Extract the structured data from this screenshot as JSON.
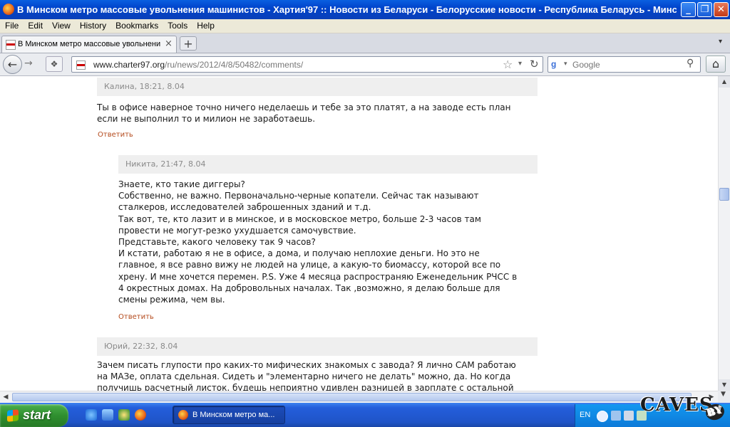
{
  "window": {
    "title": "В Минском метро массовые увольнения машинистов - Хартия'97 :: Новости из Беларуси - Белорусские новости - Республика Беларусь - Минс...",
    "minimize_glyph": "_",
    "maximize_glyph": "❐",
    "close_glyph": "✕"
  },
  "menu": [
    "File",
    "Edit",
    "View",
    "History",
    "Bookmarks",
    "Tools",
    "Help"
  ],
  "tab": {
    "label": "В Минском метро массовые увольнения ма...",
    "close_glyph": "×",
    "new_tab_glyph": "+",
    "list_glyph": "▾"
  },
  "nav": {
    "back_glyph": "←",
    "forward_glyph": "→",
    "url_host": "www.charter97.org",
    "url_path": "/ru/news/2012/4/8/50482/comments/",
    "star_glyph": "☆",
    "drop_glyph": "▾",
    "reload_glyph": "↻",
    "search_engine_glyph": "g",
    "search_placeholder": "Google",
    "search_glyph": "⚲",
    "home_glyph": "⌂"
  },
  "comments": [
    {
      "header": "Калина, 18:21, 8.04",
      "text": "Ты в офисе наверное точно ничего неделаешь и тебе за это платят, а на заводе есть план\nесли не выполнил то и милион не заработаешь.",
      "reply_label": "Ответить"
    },
    {
      "header": "Никита, 21:47, 8.04",
      "text": "Знаете, кто такие диггеры?\nСобственно, не важно. Первоначально-черные копатели. Сейчас так называют\nсталкеров, исследователей заброшенных зданий и т.д.\nТак вот, те, кто лазит и в минское, и в московское метро, больше 2-3 часов там\nпровести не могут-резко ухудшается самочувствие.\nПредставьте, какого человеку так 9 часов?\nИ кстати, работаю я не в офисе, а дома, и получаю неплохие деньги. Но это не\nглавное, я все равно вижу не людей на улице, а какую-то биомассу, которой все по\nхрену. И мне хочется перемен. P.S. Уже 4 месяца распространяю Еженедельник РЧСС в\n4 окрестных домах. На добровольных началах. Так ,возможно, я делаю больше для\nсмены режима, чем вы.",
      "reply_label": "Ответить"
    },
    {
      "header": "Юрий, 22:32, 8.04",
      "text": "Зачем писать глупости про каких-то мифических знакомых с завода? Я лично САМ работаю\nна МАЗе, оплата сдельная. Сидеть и \"элементарно ничего не делать\" можно, да. Но когда\nполучишь расчетный листок, будешь неприятно удивлен разницей в зарплате с остальной",
      "reply_label": ""
    }
  ],
  "scroll": {
    "up_glyph": "▲",
    "down_glyph": "▼",
    "left_glyph": "◀",
    "right_glyph": "▶"
  },
  "taskbar": {
    "start_label": "start",
    "task_label": "В Минском метро ма...",
    "lang": "EN"
  },
  "watermark": {
    "text": "CAVES",
    "by": "BY"
  },
  "colors": {
    "reply_link": "#b44a1c",
    "comment_header_bg": "#efefef",
    "titlebar": "#0a4fd8"
  }
}
